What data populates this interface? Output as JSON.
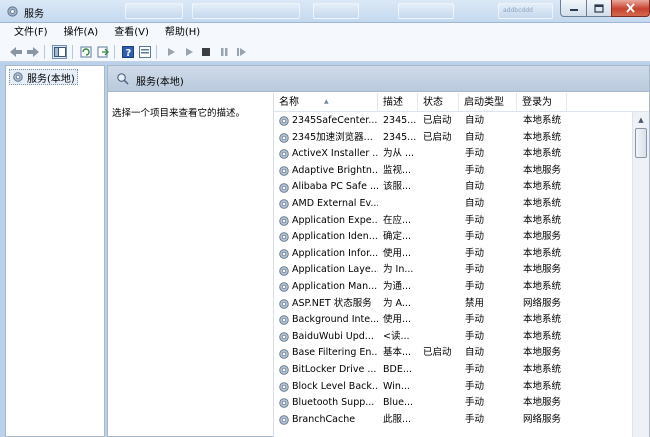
{
  "window": {
    "title": "服务",
    "ghost_label": "addbcddd"
  },
  "menu": [
    "文件(F)",
    "操作(A)",
    "查看(V)",
    "帮助(H)"
  ],
  "toolbar": [
    "back-icon",
    "forward-icon",
    "show-hide-console-tree-icon",
    "refresh-icon",
    "export-list-icon",
    "help-icon",
    "properties-icon",
    "start-service-icon",
    "start-service-alt-icon",
    "stop-service-icon",
    "pause-service-icon",
    "resume-service-icon"
  ],
  "tree": {
    "root": "服务(本地)"
  },
  "pane": {
    "header": "服务(本地)",
    "description_prompt": "选择一个项目来查看它的描述。"
  },
  "columns": {
    "name": "名称",
    "desc": "描述",
    "status": "状态",
    "start": "启动类型",
    "login": "登录为"
  },
  "services": [
    {
      "name": "2345SafeCenter...",
      "desc": "2345...",
      "status": "已启动",
      "start": "自动",
      "login": "本地系统"
    },
    {
      "name": "2345加速浏览器...",
      "desc": "2345...",
      "status": "已启动",
      "start": "自动",
      "login": "本地系统"
    },
    {
      "name": "ActiveX Installer ...",
      "desc": "为从 ...",
      "status": "",
      "start": "手动",
      "login": "本地系统"
    },
    {
      "name": "Adaptive Brightn...",
      "desc": "监视...",
      "status": "",
      "start": "手动",
      "login": "本地服务"
    },
    {
      "name": "Alibaba PC Safe ...",
      "desc": "该服...",
      "status": "",
      "start": "自动",
      "login": "本地系统"
    },
    {
      "name": "AMD External Ev...",
      "desc": "",
      "status": "",
      "start": "自动",
      "login": "本地系统"
    },
    {
      "name": "Application Expe...",
      "desc": "在应...",
      "status": "",
      "start": "手动",
      "login": "本地系统"
    },
    {
      "name": "Application Iden...",
      "desc": "确定...",
      "status": "",
      "start": "手动",
      "login": "本地服务"
    },
    {
      "name": "Application Infor...",
      "desc": "使用...",
      "status": "",
      "start": "手动",
      "login": "本地系统"
    },
    {
      "name": "Application Laye...",
      "desc": "为 In...",
      "status": "",
      "start": "手动",
      "login": "本地服务"
    },
    {
      "name": "Application Man...",
      "desc": "为通...",
      "status": "",
      "start": "手动",
      "login": "本地系统"
    },
    {
      "name": "ASP.NET 状态服务",
      "desc": "为 A...",
      "status": "",
      "start": "禁用",
      "login": "网络服务"
    },
    {
      "name": "Background Inte...",
      "desc": "使用...",
      "status": "",
      "start": "手动",
      "login": "本地系统"
    },
    {
      "name": "BaiduWubi Upd...",
      "desc": "<读...",
      "status": "",
      "start": "手动",
      "login": "本地系统"
    },
    {
      "name": "Base Filtering En...",
      "desc": "基本...",
      "status": "已启动",
      "start": "自动",
      "login": "本地服务"
    },
    {
      "name": "BitLocker Drive ...",
      "desc": "BDE...",
      "status": "",
      "start": "手动",
      "login": "本地系统"
    },
    {
      "name": "Block Level Back...",
      "desc": "Win...",
      "status": "",
      "start": "手动",
      "login": "本地系统"
    },
    {
      "name": "Bluetooth Supp...",
      "desc": "Blue...",
      "status": "",
      "start": "手动",
      "login": "本地服务"
    },
    {
      "name": "BranchCache",
      "desc": "此服...",
      "status": "",
      "start": "手动",
      "login": "网络服务"
    }
  ]
}
